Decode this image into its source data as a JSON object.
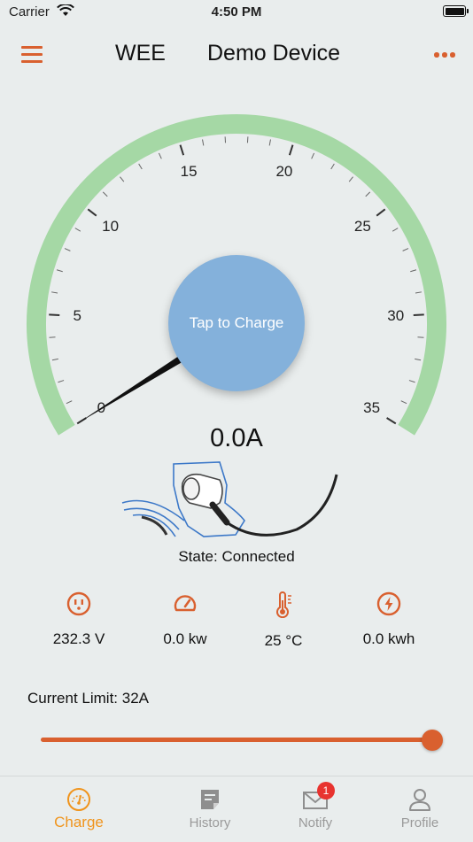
{
  "status_bar": {
    "carrier": "Carrier",
    "time": "4:50 PM"
  },
  "nav": {
    "app_name": "WEE",
    "device_name": "Demo Device"
  },
  "gauge": {
    "scale_labels": [
      "0",
      "5",
      "10",
      "15",
      "20",
      "25",
      "30",
      "35"
    ],
    "min": 0,
    "max": 35,
    "needle_value": 0,
    "charge_button_label": "Tap to Charge",
    "current_reading": "0.0A",
    "arc_color": "#a5d8a5"
  },
  "state": {
    "text": "State: Connected"
  },
  "stats": [
    {
      "icon": "outlet-icon",
      "value": "232.3 V"
    },
    {
      "icon": "speedometer-icon",
      "value": "0.0 kw"
    },
    {
      "icon": "thermometer-icon",
      "value": "25 °C"
    },
    {
      "icon": "lightning-icon",
      "value": "0.0 kwh"
    }
  ],
  "current_limit": {
    "label": "Current Limit: 32A",
    "slider_fraction": 1.0
  },
  "tabs": [
    {
      "label": "Charge",
      "icon": "gauge-icon",
      "active": true
    },
    {
      "label": "History",
      "icon": "note-icon",
      "active": false
    },
    {
      "label": "Notify",
      "icon": "mail-icon",
      "active": false,
      "badge": "1"
    },
    {
      "label": "Profile",
      "icon": "person-icon",
      "active": false
    }
  ],
  "colors": {
    "accent": "#d9602f",
    "active_tab": "#f0941c",
    "badge": "#e8332f",
    "charge_button": "#84b1db",
    "background": "#e9eded"
  }
}
